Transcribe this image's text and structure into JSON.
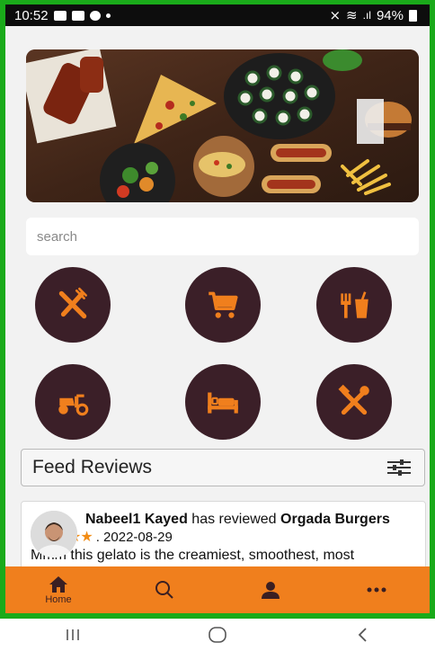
{
  "status_bar": {
    "time": "10:52",
    "battery": "94%"
  },
  "search": {
    "placeholder": "search"
  },
  "categories": [
    {
      "name": "restaurants",
      "icon": "fork-knife-icon"
    },
    {
      "name": "shopping",
      "icon": "cart-icon"
    },
    {
      "name": "food-drinks",
      "icon": "food-drink-icon"
    },
    {
      "name": "delivery",
      "icon": "scooter-icon"
    },
    {
      "name": "hotels",
      "icon": "bed-icon"
    },
    {
      "name": "services",
      "icon": "tools-icon"
    }
  ],
  "feed": {
    "title": "Feed Reviews",
    "filter_icon": "sliders-icon"
  },
  "review": {
    "user": "Nabeel1 Kayed",
    "action": "has reviewed",
    "place": "Orgada Burgers",
    "stars": "★★★★★",
    "date": ". 2022-08-29",
    "text": "Mmm this gelato is the creamiest, smoothest, most"
  },
  "bottom_nav": {
    "home_label": "Home"
  },
  "colors": {
    "accent": "#f07f1d",
    "category_bg": "#3b1f28",
    "frame": "#1aaa1a"
  }
}
